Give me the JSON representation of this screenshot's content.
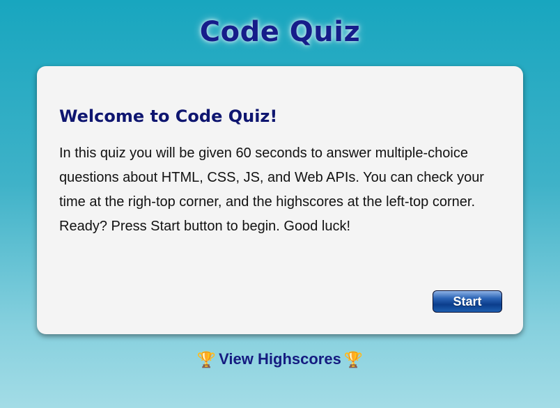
{
  "header": {
    "title": "Code Quiz"
  },
  "welcome_card": {
    "heading": "Welcome to Code Quiz!",
    "description": "In this quiz you will be given 60 seconds to answer multiple-choice questions about HTML, CSS, JS, and Web APIs. You can check your time at the righ-top corner, and the highscores at the left-top corner. Ready? Press Start button to begin. Good luck!",
    "start_label": "Start"
  },
  "footer": {
    "highscores_label": "View Highscores",
    "trophy_glyph": "🏆"
  }
}
